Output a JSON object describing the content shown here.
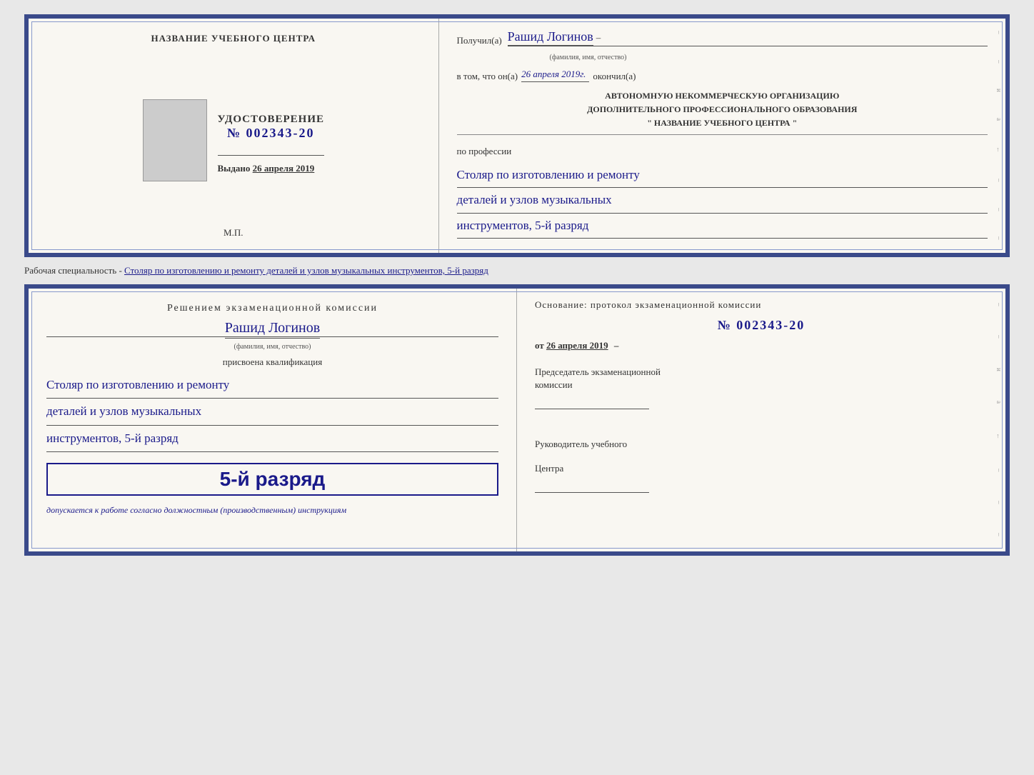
{
  "page": {
    "background": "#e8e8e8"
  },
  "top_doc": {
    "left": {
      "center_name": "НАЗВАНИЕ УЧЕБНОГО ЦЕНТРА",
      "udostoverenie_label": "УДОСТОВЕРЕНИЕ",
      "number": "№ 002343-20",
      "vydano_label": "Выдано",
      "vydano_date": "26 апреля 2019",
      "mp_label": "М.П."
    },
    "right": {
      "poluchil_label": "Получил(а)",
      "recipient_name": "Рашид Логинов",
      "fio_label": "(фамилия, имя, отчество)",
      "v_tom_chto": "в том, что он(а)",
      "date_value": "26 апреля 2019г.",
      "okonchil_label": "окончил(а)",
      "org_line1": "АВТОНОМНУЮ НЕКОММЕРЧЕСКУЮ ОРГАНИЗАЦИЮ",
      "org_line2": "ДОПОЛНИТЕЛЬНОГО ПРОФЕССИОНАЛЬНОГО ОБРАЗОВАНИЯ",
      "org_name": "\"  НАЗВАНИЕ УЧЕБНОГО ЦЕНТРА  \"",
      "po_professii_label": "по профессии",
      "profession_line1": "Столяр по изготовлению и ремонту",
      "profession_line2": "деталей и узлов музыкальных",
      "profession_line3": "инструментов, 5-й разряд"
    }
  },
  "spec_description": {
    "prefix": "Рабочая специальность - ",
    "value": "Столяр по изготовлению и ремонту деталей и узлов музыкальных инструментов, 5-й разряд"
  },
  "bottom_doc": {
    "left": {
      "resheniem_label": "Решением экзаменационной комиссии",
      "person_name": "Рашид Логинов",
      "fio_label": "(фамилия, имя, отчество)",
      "prisvoena_label": "присвоена квалификация",
      "qual_line1": "Столяр по изготовлению и ремонту",
      "qual_line2": "деталей и узлов музыкальных",
      "qual_line3": "инструментов, 5-й разряд",
      "rank_label": "5-й разряд",
      "dopuskaetsya": "допускается к",
      "work_description": "работе согласно должностным (производственным) инструкциям"
    },
    "right": {
      "osnovanie_label": "Основание: протокол экзаменационной комиссии",
      "protocol_number": "№  002343-20",
      "ot_label": "от",
      "ot_date": "26 апреля 2019",
      "chairman_line1": "Председатель экзаменационной",
      "chairman_line2": "комиссии",
      "rukovoditel_line1": "Руководитель учебного",
      "rukovoditel_line2": "Центра"
    }
  }
}
